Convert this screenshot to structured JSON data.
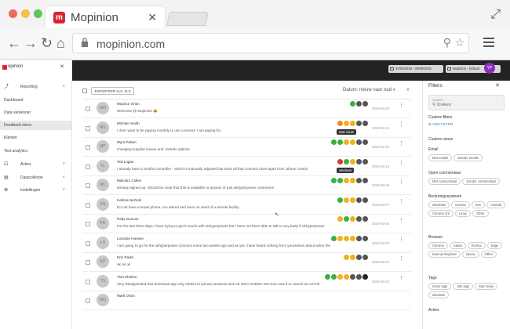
{
  "browser": {
    "tab_title": "Mopinion",
    "tab_logo": "m",
    "url": "mopinion.com",
    "colors": {
      "close": "#ed6a5e",
      "min": "#f5bf4f",
      "max": "#62c655"
    }
  },
  "sidebar": {
    "brand": "opinion",
    "items": [
      {
        "label": "Reporting",
        "icon": "chart-line-icon"
      },
      {
        "label": "Dashboard"
      },
      {
        "label": "Data verkenner"
      },
      {
        "label": "Feedback inbox"
      },
      {
        "label": "Klanten"
      },
      {
        "label": "Text analytics"
      },
      {
        "label": "Acties",
        "icon": "check-square-icon"
      },
      {
        "label": "Datacollectie",
        "icon": "database-icon"
      },
      {
        "label": "Instellingen",
        "icon": "gear-icon"
      }
    ]
  },
  "topbar": {
    "date_range": "20/09/2019 - 20/09/2019",
    "project": "Mopinion - Default",
    "avatar": "YP"
  },
  "toolbar": {
    "export_label": "EXPORTEER ALS .XLS",
    "sort_label": "Datum: nieuw naar oud"
  },
  "feedback": [
    {
      "initials": "MO",
      "name": "Maurice Orion",
      "text": "Welcome @ Mopinion 😀",
      "date": "2019-09-20",
      "icons": [
        "g",
        "d",
        "d"
      ]
    },
    {
      "initials": "MS",
      "name": "Michele Smith",
      "text": "I don't want to be paying monthly to use a service I am paying for.",
      "date": "2019-09-14",
      "icons": [
        "o",
        "y",
        "y",
        "d",
        "d"
      ],
      "tooltip": "Mac issue"
    },
    {
      "initials": "MP",
      "name": "Myra Patton",
      "text": "changing supplier issues and controls options",
      "date": "2019-09-12",
      "icons": [
        "g",
        "g",
        "y",
        "y",
        "d",
        "d"
      ]
    },
    {
      "initials": "TL",
      "name": "Ted Logan",
      "text": "I already have a Smiths Controller - which is manually adjusted but does all that Connect does apart from 'phone control",
      "date": "2019-09-12",
      "icons": [
        "r",
        "g",
        "y",
        "d",
        "d"
      ],
      "tooltip": "windows"
    },
    {
      "initials": "MC",
      "name": "Malcolm Collier",
      "text": "already signed up. Should be clear that this is available to anyone or just ukhyperpower customers",
      "date": "2019-09-09",
      "icons": [
        "g",
        "g",
        "y",
        "y",
        "d",
        "d"
      ]
    },
    {
      "initials": "KN",
      "name": "Katrina Nichols",
      "text": "Do not have a smart phone. Am retired and have no need of a remote facility.",
      "date": "2019-09-07",
      "icons": [
        "g",
        "y",
        "y",
        "d",
        "d"
      ]
    },
    {
      "initials": "PD",
      "name": "Patty Duncan",
      "text": "For the last three days I have trying to get in touch with ukhyperpower but I have not been able to talk to any body If ukhyperpower",
      "date": "2019-09-05",
      "icons": [
        "y",
        "g",
        "y",
        "d",
        "d"
      ]
    },
    {
      "initials": "LH",
      "name": "Lorraine Hansen",
      "text": "I am going to go for the ukhyperpower Connect some two weeks ago and as yet I have heard nothing from yourselves about when the",
      "date": "2019-09-02",
      "icons": [
        "g",
        "y",
        "y",
        "y",
        "d",
        "d"
      ]
    },
    {
      "initials": "EP",
      "name": "Erin Parks",
      "text": "ok ok ok",
      "date": "2019-08-22",
      "icons": [
        "y",
        "y",
        "d",
        "d"
      ]
    },
    {
      "initials": "TS",
      "name": "Tina Shelton",
      "text": "Very Disappointed that download app only relates to iphone products and not other mobiles Not sure now if to cancel as not full",
      "date": "2019-08-22",
      "icons": [
        "g",
        "g",
        "y",
        "y",
        "d",
        "d",
        "k"
      ]
    },
    {
      "initials": "MO",
      "name": "Mark Orion",
      "text": "",
      "date": "",
      "icons": []
    }
  ],
  "filters": {
    "title": "Filters",
    "search_label": "Zoeken",
    "search_placeholder": "Zoeken",
    "custom_filters": "Custom filters",
    "add_filter": "ADD FILTER",
    "custom_views": "Custom views",
    "sections": [
      {
        "title": "Email",
        "chips": [
          "Met emails",
          "Zonder emails"
        ]
      },
      {
        "title": "Open commentaar",
        "chips": [
          "Met commentaar",
          "Zonder commentaar"
        ]
      },
      {
        "title": "Besturingssysteem",
        "chips": [
          "Windows",
          "macOS",
          "iOS",
          "Android",
          "Chrome OS",
          "Linux",
          "Other"
        ]
      },
      {
        "title": "Browser",
        "chips": [
          "Chrome",
          "Safari",
          "Firefox",
          "Edge",
          "Internet Explorer",
          "Opera",
          "Other"
        ]
      },
      {
        "title": "Tags",
        "chips": [
          "Geen tags",
          "Alle tags",
          "Mac issue",
          "windows"
        ]
      },
      {
        "title": "Acties",
        "chips": []
      }
    ]
  }
}
